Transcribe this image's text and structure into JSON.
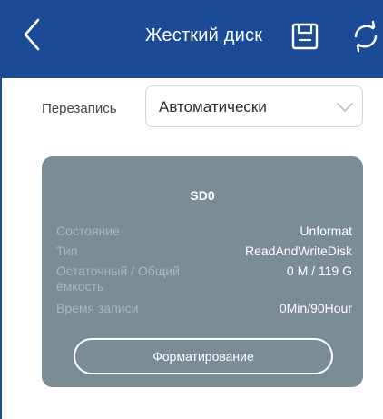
{
  "header": {
    "title": "Жесткий диск",
    "back_icon": "chevron-left-icon",
    "save_icon": "floppy-disk-icon",
    "refresh_icon": "refresh-icon",
    "background_color": "#1b4b96"
  },
  "overwrite": {
    "label": "Перезапись",
    "selected_value": "Автоматически",
    "dropdown_icon": "chevron-down-icon"
  },
  "disk_card": {
    "name": "SD0",
    "background_color": "#7b8c95",
    "rows": [
      {
        "label": "Состояние",
        "value": "Unformat"
      },
      {
        "label": "Тип",
        "value": "ReadAndWriteDisk"
      },
      {
        "label": "Остаточный / Общий ёмкость",
        "value": "0 M / 119 G"
      },
      {
        "label": "Время записи",
        "value": "0Min/90Hour"
      }
    ],
    "format_button": "Форматирование"
  }
}
